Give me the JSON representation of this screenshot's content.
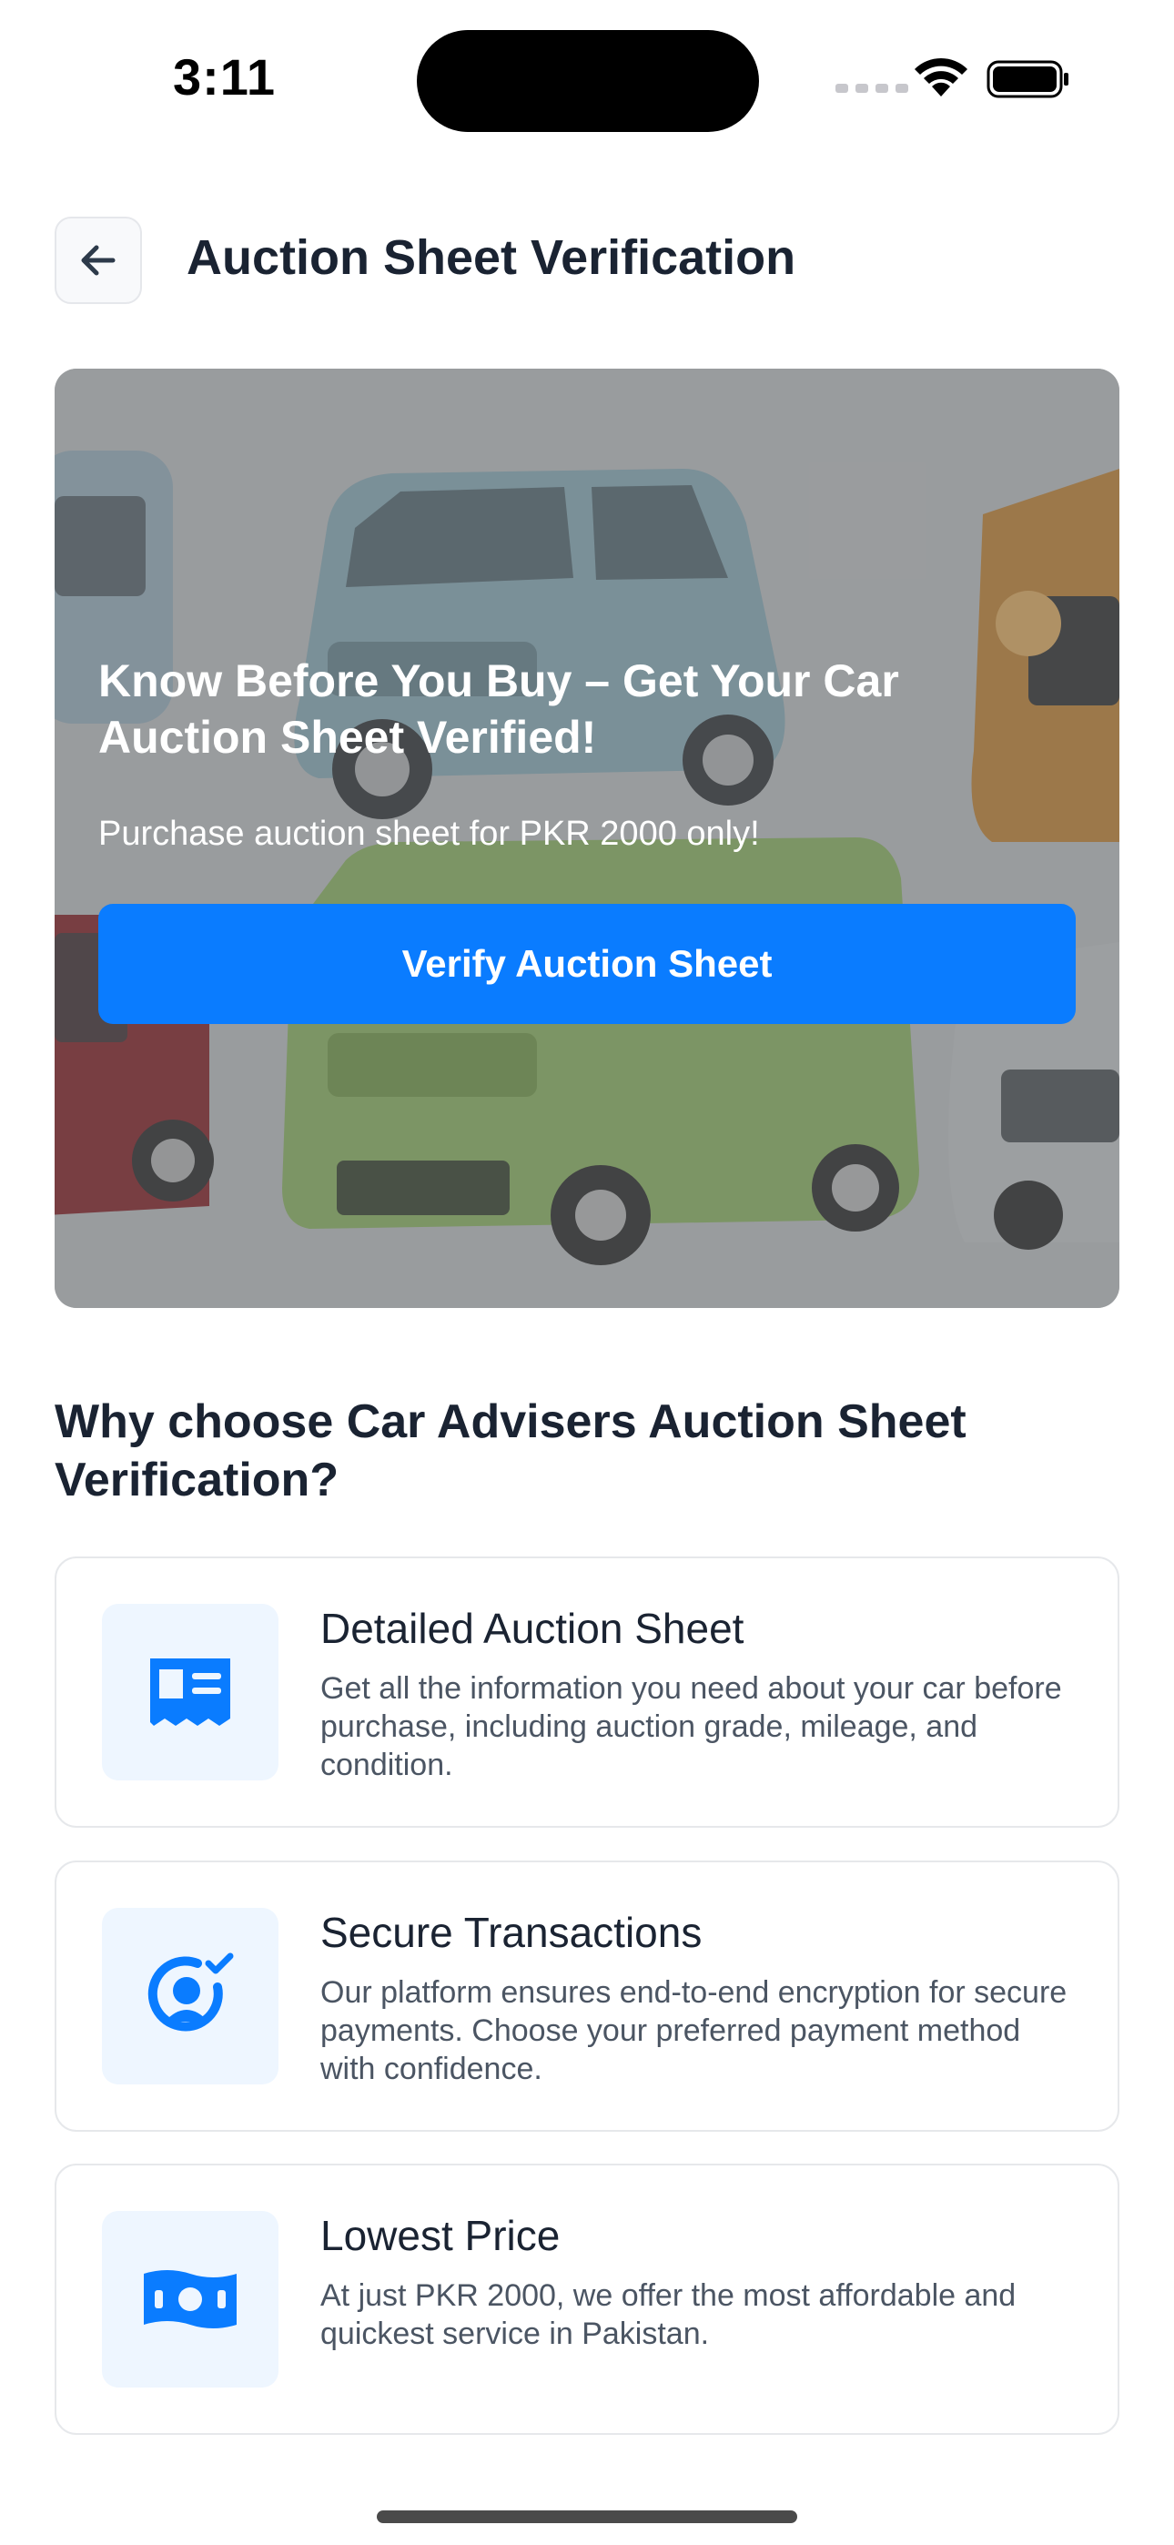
{
  "status_bar": {
    "time": "3:11"
  },
  "header": {
    "title": "Auction Sheet Verification",
    "back_icon": "arrow-left-icon"
  },
  "hero": {
    "headline": "Know Before You Buy – Get Your Car Auction Sheet Verified!",
    "subtext": "Purchase auction sheet for PKR 2000 only!",
    "button_label": "Verify Auction Sheet"
  },
  "section": {
    "title": "Why choose Car Advisers Auction Sheet Verification?"
  },
  "features": [
    {
      "icon": "document-icon",
      "title": "Detailed Auction Sheet",
      "description": "Get all the information you need about your car before purchase, including auction grade, mileage, and condition."
    },
    {
      "icon": "secure-user-icon",
      "title": "Secure Transactions",
      "description": "Our platform ensures end-to-end encryption for secure payments. Choose your preferred payment method with confidence."
    },
    {
      "icon": "banknote-icon",
      "title": "Lowest Price",
      "description": "At just PKR 2000, we offer the most affordable and quickest service in Pakistan."
    }
  ],
  "colors": {
    "accent": "#0a7cff",
    "icon_bg": "#eef6ff",
    "text_dark": "#1a2332",
    "text_muted": "#4b5563"
  }
}
